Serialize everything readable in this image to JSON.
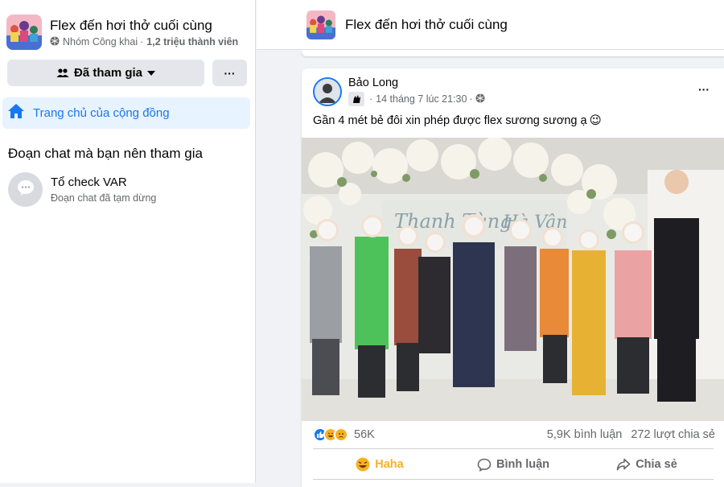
{
  "group": {
    "name": "Flex đến hơi thở cuối cùng",
    "privacy": "Nhóm Công khai",
    "separator": "·",
    "members": "1,2 triệu thành viên"
  },
  "sidebar": {
    "joined_label": "Đã tham gia",
    "more_label": "···",
    "home_label": "Trang chủ của cộng đồng",
    "chats_section_title": "Đoạn chat mà bạn nên tham gia",
    "chat": {
      "name": "Tổ check VAR",
      "status": "Đoạn chat đã tạm dừng"
    }
  },
  "post": {
    "author": "Bảo Long",
    "timestamp": "14 tháng 7 lúc 21:30",
    "dot": "·",
    "more_label": "···",
    "text": "Gần 4 mét bẻ đôi xin phép được flex sương sương ạ",
    "text_emoji": "😉",
    "reaction_count": "56K",
    "comment_count": "5,9K bình luận",
    "share_count": "272 lượt chia sẻ",
    "actions": {
      "haha": "Haha",
      "comment": "Bình luận",
      "share": "Chia sẻ"
    }
  },
  "icons": {
    "globe": "globe-icon",
    "people": "people-icon",
    "home": "home-icon",
    "chat": "chat-bubble-icon",
    "comment": "comment-icon",
    "share": "share-icon"
  },
  "colors": {
    "accent": "#1877f2",
    "haha": "#f7b125",
    "like": "#1877f2",
    "love": "#f33e58"
  }
}
